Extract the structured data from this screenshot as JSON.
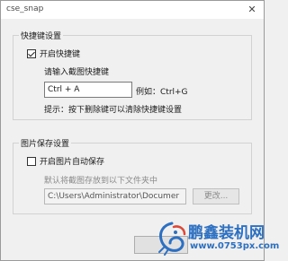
{
  "window": {
    "title": "cse_snap",
    "close_glyph": "✕"
  },
  "hotkey_group": {
    "title": "快捷键设置",
    "enable_label": "开启快捷键",
    "enable_checked": true,
    "prompt": "请输入截图快捷键",
    "hotkey_value": "Ctrl + A",
    "example": "例如：Ctrl+G",
    "hint": "提示：按下删除键可以清除快捷键设置"
  },
  "save_group": {
    "title": "图片保存设置",
    "autosave_label": "开启图片自动保存",
    "autosave_checked": false,
    "desc": "默认将截图存放到以下文件夹中",
    "path_value": "C:\\Users\\Administrator\\Documer",
    "change_button": "更改..."
  },
  "watermark": {
    "brand": "鹏鑫装机网",
    "url": "www.0753px.com",
    "logo_icon": "dragon-logo-icon",
    "color": "#2d6fc0"
  }
}
